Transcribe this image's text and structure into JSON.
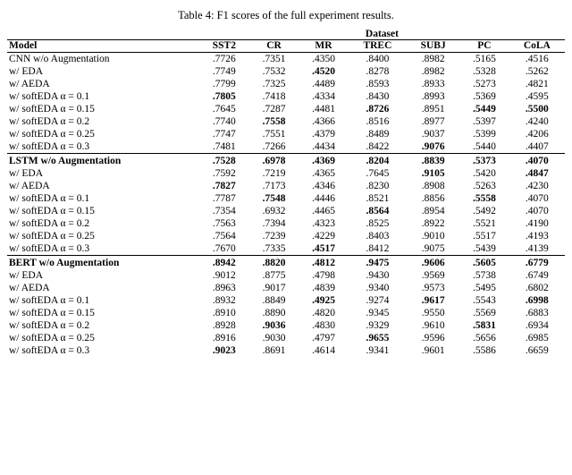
{
  "title": "Table 4: F1 scores of the full experiment results.",
  "columns": {
    "group_header": "Dataset",
    "headers": [
      "Model",
      "SST2",
      "CR",
      "MR",
      "TREC",
      "SUBJ",
      "PC",
      "CoLA"
    ]
  },
  "rows": [
    {
      "model": "CNN w/o Augmentation",
      "sst2": ".7726",
      "cr": ".7351",
      "mr": ".4350",
      "trec": ".8400",
      "subj": ".8982",
      "pc": ".5165",
      "cola": ".4516",
      "bold": []
    },
    {
      "model": "w/ EDA",
      "sst2": ".7749",
      "cr": ".7532",
      "mr": ".4520",
      "trec": ".8278",
      "subj": ".8982",
      "pc": ".5328",
      "cola": ".5262",
      "bold": [
        "mr"
      ]
    },
    {
      "model": "w/ AEDA",
      "sst2": ".7799",
      "cr": ".7325",
      "mr": ".4489",
      "trec": ".8593",
      "subj": ".8933",
      "pc": ".5273",
      "cola": ".4821",
      "bold": []
    },
    {
      "model": "w/ softEDA α = 0.1",
      "sst2": ".7805",
      "cr": ".7418",
      "mr": ".4334",
      "trec": ".8430",
      "subj": ".8993",
      "pc": ".5369",
      "cola": ".4595",
      "bold": [
        "sst2"
      ]
    },
    {
      "model": "w/ softEDA α = 0.15",
      "sst2": ".7645",
      "cr": ".7287",
      "mr": ".4481",
      "trec": ".8726",
      "subj": ".8951",
      "pc": ".5449",
      "cola": ".5500",
      "bold": [
        "trec",
        "pc",
        "cola"
      ]
    },
    {
      "model": "w/ softEDA α = 0.2",
      "sst2": ".7740",
      "cr": ".7558",
      "mr": ".4366",
      "trec": ".8516",
      "subj": ".8977",
      "pc": ".5397",
      "cola": ".4240",
      "bold": [
        "cr"
      ]
    },
    {
      "model": "w/ softEDA α = 0.25",
      "sst2": ".7747",
      "cr": ".7551",
      "mr": ".4379",
      "trec": ".8489",
      "subj": ".9037",
      "pc": ".5399",
      "cola": ".4206",
      "bold": []
    },
    {
      "model": "w/ softEDA α = 0.3",
      "sst2": ".7481",
      "cr": ".7266",
      "mr": ".4434",
      "trec": ".8422",
      "subj": ".9076",
      "pc": ".5440",
      "cola": ".4407",
      "bold": [
        "subj"
      ]
    },
    {
      "model": "LSTM w/o Augmentation",
      "sst2": ".7528",
      "cr": ".6978",
      "mr": ".4369",
      "trec": ".8204",
      "subj": ".8839",
      "pc": ".5373",
      "cola": ".4070",
      "bold": [],
      "section": true
    },
    {
      "model": "w/ EDA",
      "sst2": ".7592",
      "cr": ".7219",
      "mr": ".4365",
      "trec": ".7645",
      "subj": ".9105",
      "pc": ".5420",
      "cola": ".4847",
      "bold": [
        "subj",
        "cola"
      ]
    },
    {
      "model": "w/ AEDA",
      "sst2": ".7827",
      "cr": ".7173",
      "mr": ".4346",
      "trec": ".8230",
      "subj": ".8908",
      "pc": ".5263",
      "cola": ".4230",
      "bold": [
        "sst2"
      ]
    },
    {
      "model": "w/ softEDA α = 0.1",
      "sst2": ".7787",
      "cr": ".7548",
      "mr": ".4446",
      "trec": ".8521",
      "subj": ".8856",
      "pc": ".5558",
      "cola": ".4070",
      "bold": [
        "cr",
        "pc"
      ]
    },
    {
      "model": "w/ softEDA α = 0.15",
      "sst2": ".7354",
      "cr": ".6932",
      "mr": ".4465",
      "trec": ".8564",
      "subj": ".8954",
      "pc": ".5492",
      "cola": ".4070",
      "bold": [
        "trec"
      ]
    },
    {
      "model": "w/ softEDA α = 0.2",
      "sst2": ".7563",
      "cr": ".7394",
      "mr": ".4323",
      "trec": ".8525",
      "subj": ".8922",
      "pc": ".5521",
      "cola": ".4190",
      "bold": []
    },
    {
      "model": "w/ softEDA α = 0.25",
      "sst2": ".7564",
      "cr": ".7239",
      "mr": ".4229",
      "trec": ".8403",
      "subj": ".9010",
      "pc": ".5517",
      "cola": ".4193",
      "bold": []
    },
    {
      "model": "w/ softEDA α = 0.3",
      "sst2": ".7670",
      "cr": ".7335",
      "mr": ".4517",
      "trec": ".8412",
      "subj": ".9075",
      "pc": ".5439",
      "cola": ".4139",
      "bold": [
        "mr"
      ]
    },
    {
      "model": "BERT w/o Augmentation",
      "sst2": ".8942",
      "cr": ".8820",
      "mr": ".4812",
      "trec": ".9475",
      "subj": ".9606",
      "pc": ".5605",
      "cola": ".6779",
      "bold": [],
      "section": true
    },
    {
      "model": "w/ EDA",
      "sst2": ".9012",
      "cr": ".8775",
      "mr": ".4798",
      "trec": ".9430",
      "subj": ".9569",
      "pc": ".5738",
      "cola": ".6749",
      "bold": []
    },
    {
      "model": "w/ AEDA",
      "sst2": ".8963",
      "cr": ".9017",
      "mr": ".4839",
      "trec": ".9340",
      "subj": ".9573",
      "pc": ".5495",
      "cola": ".6802",
      "bold": []
    },
    {
      "model": "w/ softEDA α = 0.1",
      "sst2": ".8932",
      "cr": ".8849",
      "mr": ".4925",
      "trec": ".9274",
      "subj": ".9617",
      "pc": ".5543",
      "cola": ".6998",
      "bold": [
        "mr",
        "subj",
        "cola"
      ]
    },
    {
      "model": "w/ softEDA α = 0.15",
      "sst2": ".8910",
      "cr": ".8890",
      "mr": ".4820",
      "trec": ".9345",
      "subj": ".9550",
      "pc": ".5569",
      "cola": ".6883",
      "bold": []
    },
    {
      "model": "w/ softEDA α = 0.2",
      "sst2": ".8928",
      "cr": ".9036",
      "mr": ".4830",
      "trec": ".9329",
      "subj": ".9610",
      "pc": ".5831",
      "cola": ".6934",
      "bold": [
        "cr",
        "pc"
      ]
    },
    {
      "model": "w/ softEDA α = 0.25",
      "sst2": ".8916",
      "cr": ".9030",
      "mr": ".4797",
      "trec": ".9655",
      "subj": ".9596",
      "pc": ".5656",
      "cola": ".6985",
      "bold": [
        "trec"
      ]
    },
    {
      "model": "w/ softEDA α = 0.3",
      "sst2": ".9023",
      "cr": ".8691",
      "mr": ".4614",
      "trec": ".9341",
      "subj": ".9601",
      "pc": ".5586",
      "cola": ".6659",
      "bold": [
        "sst2"
      ]
    }
  ]
}
